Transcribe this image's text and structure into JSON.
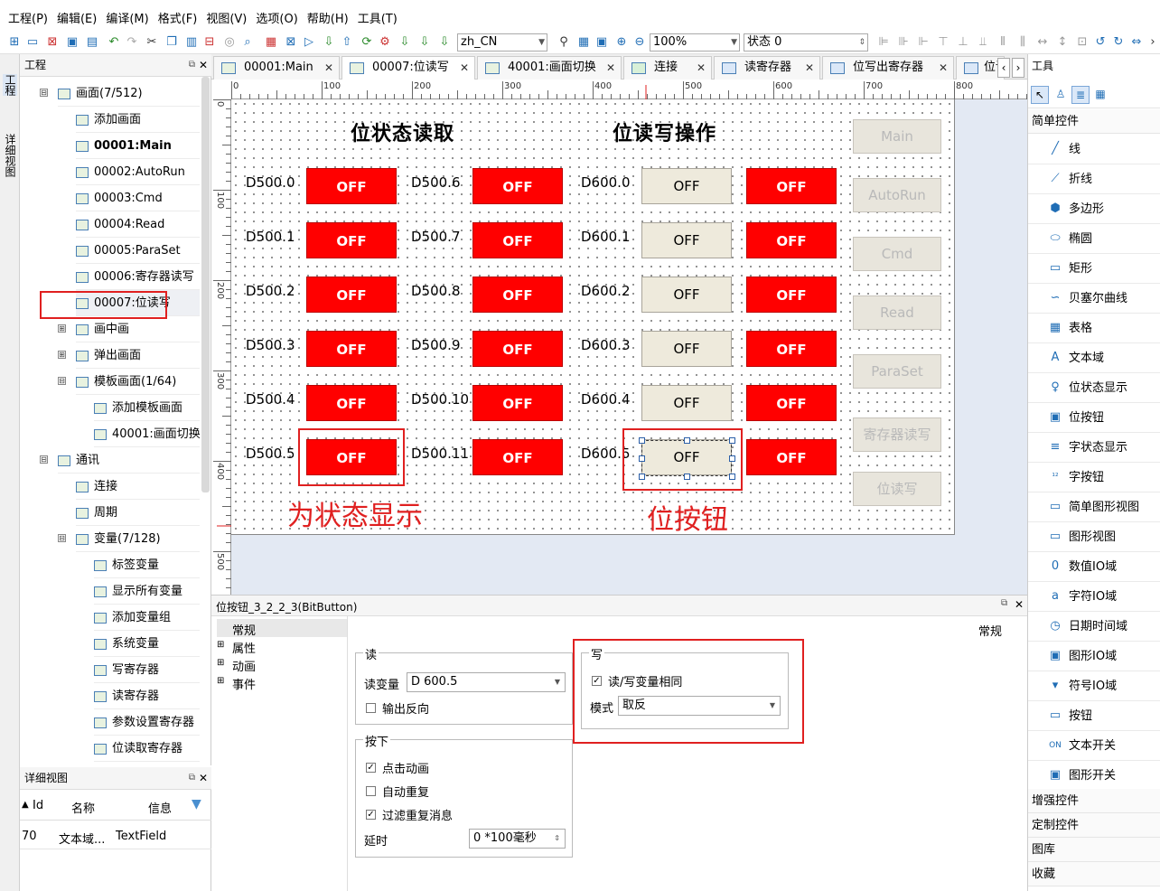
{
  "menubar": {
    "items": [
      "工程(P)",
      "编辑(E)",
      "编译(M)",
      "格式(F)",
      "视图(V)",
      "选项(O)",
      "帮助(H)",
      "工具(T)"
    ]
  },
  "toolbar": {
    "language": "zh_CN",
    "zoom": "100%",
    "state": "状态 0"
  },
  "left_strip": {
    "tabs": [
      "工程",
      "详细视图"
    ]
  },
  "project_panel": {
    "title": "工程"
  },
  "tree": [
    {
      "label": "画面(7/512)",
      "depth": 0,
      "expander": "⊟",
      "bold": false
    },
    {
      "label": "添加画面",
      "depth": 1,
      "expander": "",
      "bold": false
    },
    {
      "label": "00001:Main",
      "depth": 1,
      "expander": "",
      "bold": true
    },
    {
      "label": "00002:AutoRun",
      "depth": 1,
      "expander": "",
      "bold": false
    },
    {
      "label": "00003:Cmd",
      "depth": 1,
      "expander": "",
      "bold": false
    },
    {
      "label": "00004:Read",
      "depth": 1,
      "expander": "",
      "bold": false
    },
    {
      "label": "00005:ParaSet",
      "depth": 1,
      "expander": "",
      "bold": false
    },
    {
      "label": "00006:寄存器读写",
      "depth": 1,
      "expander": "",
      "bold": false
    },
    {
      "label": "00007:位读写",
      "depth": 1,
      "expander": "",
      "bold": false
    },
    {
      "label": "画中画",
      "depth": 1,
      "expander": "⊞",
      "bold": false
    },
    {
      "label": "弹出画面",
      "depth": 1,
      "expander": "⊞",
      "bold": false
    },
    {
      "label": "模板画面(1/64)",
      "depth": 1,
      "expander": "⊟",
      "bold": false
    },
    {
      "label": "添加模板画面",
      "depth": 2,
      "expander": "",
      "bold": false
    },
    {
      "label": "40001:画面切换",
      "depth": 2,
      "expander": "",
      "bold": false
    },
    {
      "label": "通讯",
      "depth": 0,
      "expander": "⊟",
      "bold": false
    },
    {
      "label": "连接",
      "depth": 1,
      "expander": "",
      "bold": false
    },
    {
      "label": "周期",
      "depth": 1,
      "expander": "",
      "bold": false
    },
    {
      "label": "变量(7/128)",
      "depth": 1,
      "expander": "⊟",
      "bold": false
    },
    {
      "label": "标签变量",
      "depth": 2,
      "expander": "",
      "bold": false
    },
    {
      "label": "显示所有变量",
      "depth": 2,
      "expander": "",
      "bold": false
    },
    {
      "label": "添加变量组",
      "depth": 2,
      "expander": "",
      "bold": false
    },
    {
      "label": "系统变量",
      "depth": 2,
      "expander": "",
      "bold": false
    },
    {
      "label": "写寄存器",
      "depth": 2,
      "expander": "",
      "bold": false
    },
    {
      "label": "读寄存器",
      "depth": 2,
      "expander": "",
      "bold": false
    },
    {
      "label": "参数设置寄存器",
      "depth": 2,
      "expander": "",
      "bold": false
    },
    {
      "label": "位读取寄存器",
      "depth": 2,
      "expander": "",
      "bold": false
    }
  ],
  "detail_panel": {
    "title": "详细视图",
    "columns": [
      "Id",
      "名称",
      "信息"
    ],
    "row": [
      "70",
      "文本域...",
      "TextField"
    ]
  },
  "editor_tabs": [
    "00001:Main",
    "00007:位读写",
    "40001:画面切换",
    "连接",
    "读寄存器",
    "位写出寄存器",
    "位读"
  ],
  "ruler": {
    "h": [
      "0",
      "100",
      "200",
      "300",
      "400",
      "500",
      "600",
      "700",
      "800"
    ],
    "v": [
      "0",
      "100",
      "200",
      "300",
      "400",
      "500"
    ]
  },
  "canvas": {
    "title_left": "位状态读取",
    "title_right": "位读写操作",
    "col1_labels": [
      "D500.0",
      "D500.1",
      "D500.2",
      "D500.3",
      "D500.4",
      "D500.5"
    ],
    "col2_labels": [
      "D500.6",
      "D500.7",
      "D500.8",
      "D500.9",
      "D500.10",
      "D500.11"
    ],
    "col3_labels": [
      "D600.0",
      "D600.1",
      "D600.2",
      "D600.3",
      "D600.4",
      "D600.5"
    ],
    "off_label": "OFF",
    "nav_buttons": [
      "Main",
      "AutoRun",
      "Cmd",
      "Read",
      "ParaSet",
      "寄存器读写",
      "位读写"
    ],
    "annotation_status": "为状态显示",
    "annotation_button": "位按钮"
  },
  "colors": {
    "status_off": "#ff0000",
    "annotation": "#e02020",
    "bitbutton": "#eeeadc"
  },
  "properties": {
    "title": "位按钮_3_2_2_3(BitButton)",
    "nav": [
      {
        "label": "常规",
        "exp": ""
      },
      {
        "label": "属性",
        "exp": "⊞"
      },
      {
        "label": "动画",
        "exp": "⊞"
      },
      {
        "label": "事件",
        "exp": "⊞"
      }
    ],
    "section_label": "常规",
    "read_group": {
      "title": "读",
      "var_label": "读变量",
      "var_value": "D 600.5",
      "invert_label": "输出反向"
    },
    "write_group": {
      "title": "写",
      "same_label": "读/写变量相同",
      "mode_label": "模式",
      "mode_value": "取反"
    },
    "press_group": {
      "title": "按下",
      "click_anim": "点击动画",
      "auto_repeat": "自动重复",
      "filter_repeat": "过滤重复消息",
      "delay_label": "延时",
      "delay_value": "0 *100毫秒"
    }
  },
  "tools_panel": {
    "title": "工具",
    "category_simple": "简单控件",
    "items": [
      {
        "label": "线",
        "icon": "line-icon",
        "glyph": "╱"
      },
      {
        "label": "折线",
        "icon": "polyline-icon",
        "glyph": "⟋"
      },
      {
        "label": "多边形",
        "icon": "polygon-icon",
        "glyph": "⬢"
      },
      {
        "label": "椭圆",
        "icon": "ellipse-icon",
        "glyph": "⬭"
      },
      {
        "label": "矩形",
        "icon": "rectangle-icon",
        "glyph": "▭"
      },
      {
        "label": "贝塞尔曲线",
        "icon": "bezier-icon",
        "glyph": "∽"
      },
      {
        "label": "表格",
        "icon": "table-icon",
        "glyph": "▦"
      },
      {
        "label": "文本域",
        "icon": "text-field-icon",
        "glyph": "A"
      },
      {
        "label": "位状态显示",
        "icon": "bit-status-icon",
        "glyph": "♀"
      },
      {
        "label": "位按钮",
        "icon": "bit-button-icon",
        "glyph": "▣"
      },
      {
        "label": "字状态显示",
        "icon": "word-status-icon",
        "glyph": "≡"
      },
      {
        "label": "字按钮",
        "icon": "word-button-icon",
        "glyph": "¹²"
      },
      {
        "label": "简单图形视图",
        "icon": "simple-graphic-icon",
        "glyph": "▭"
      },
      {
        "label": "图形视图",
        "icon": "graphic-view-icon",
        "glyph": "▭"
      },
      {
        "label": "数值IO域",
        "icon": "numeric-io-icon",
        "glyph": "0"
      },
      {
        "label": "字符IO域",
        "icon": "char-io-icon",
        "glyph": "a"
      },
      {
        "label": "日期时间域",
        "icon": "datetime-icon",
        "glyph": "◷"
      },
      {
        "label": "图形IO域",
        "icon": "graphic-io-icon",
        "glyph": "▣"
      },
      {
        "label": "符号IO域",
        "icon": "symbol-io-icon",
        "glyph": "▾"
      },
      {
        "label": "按钮",
        "icon": "button-icon",
        "glyph": "▭"
      },
      {
        "label": "文本开关",
        "icon": "text-switch-icon",
        "glyph": "ON"
      },
      {
        "label": "图形开关",
        "icon": "graphic-switch-icon",
        "glyph": "▣"
      }
    ],
    "categories_bottom": [
      "增强控件",
      "定制控件",
      "图库",
      "收藏"
    ]
  }
}
